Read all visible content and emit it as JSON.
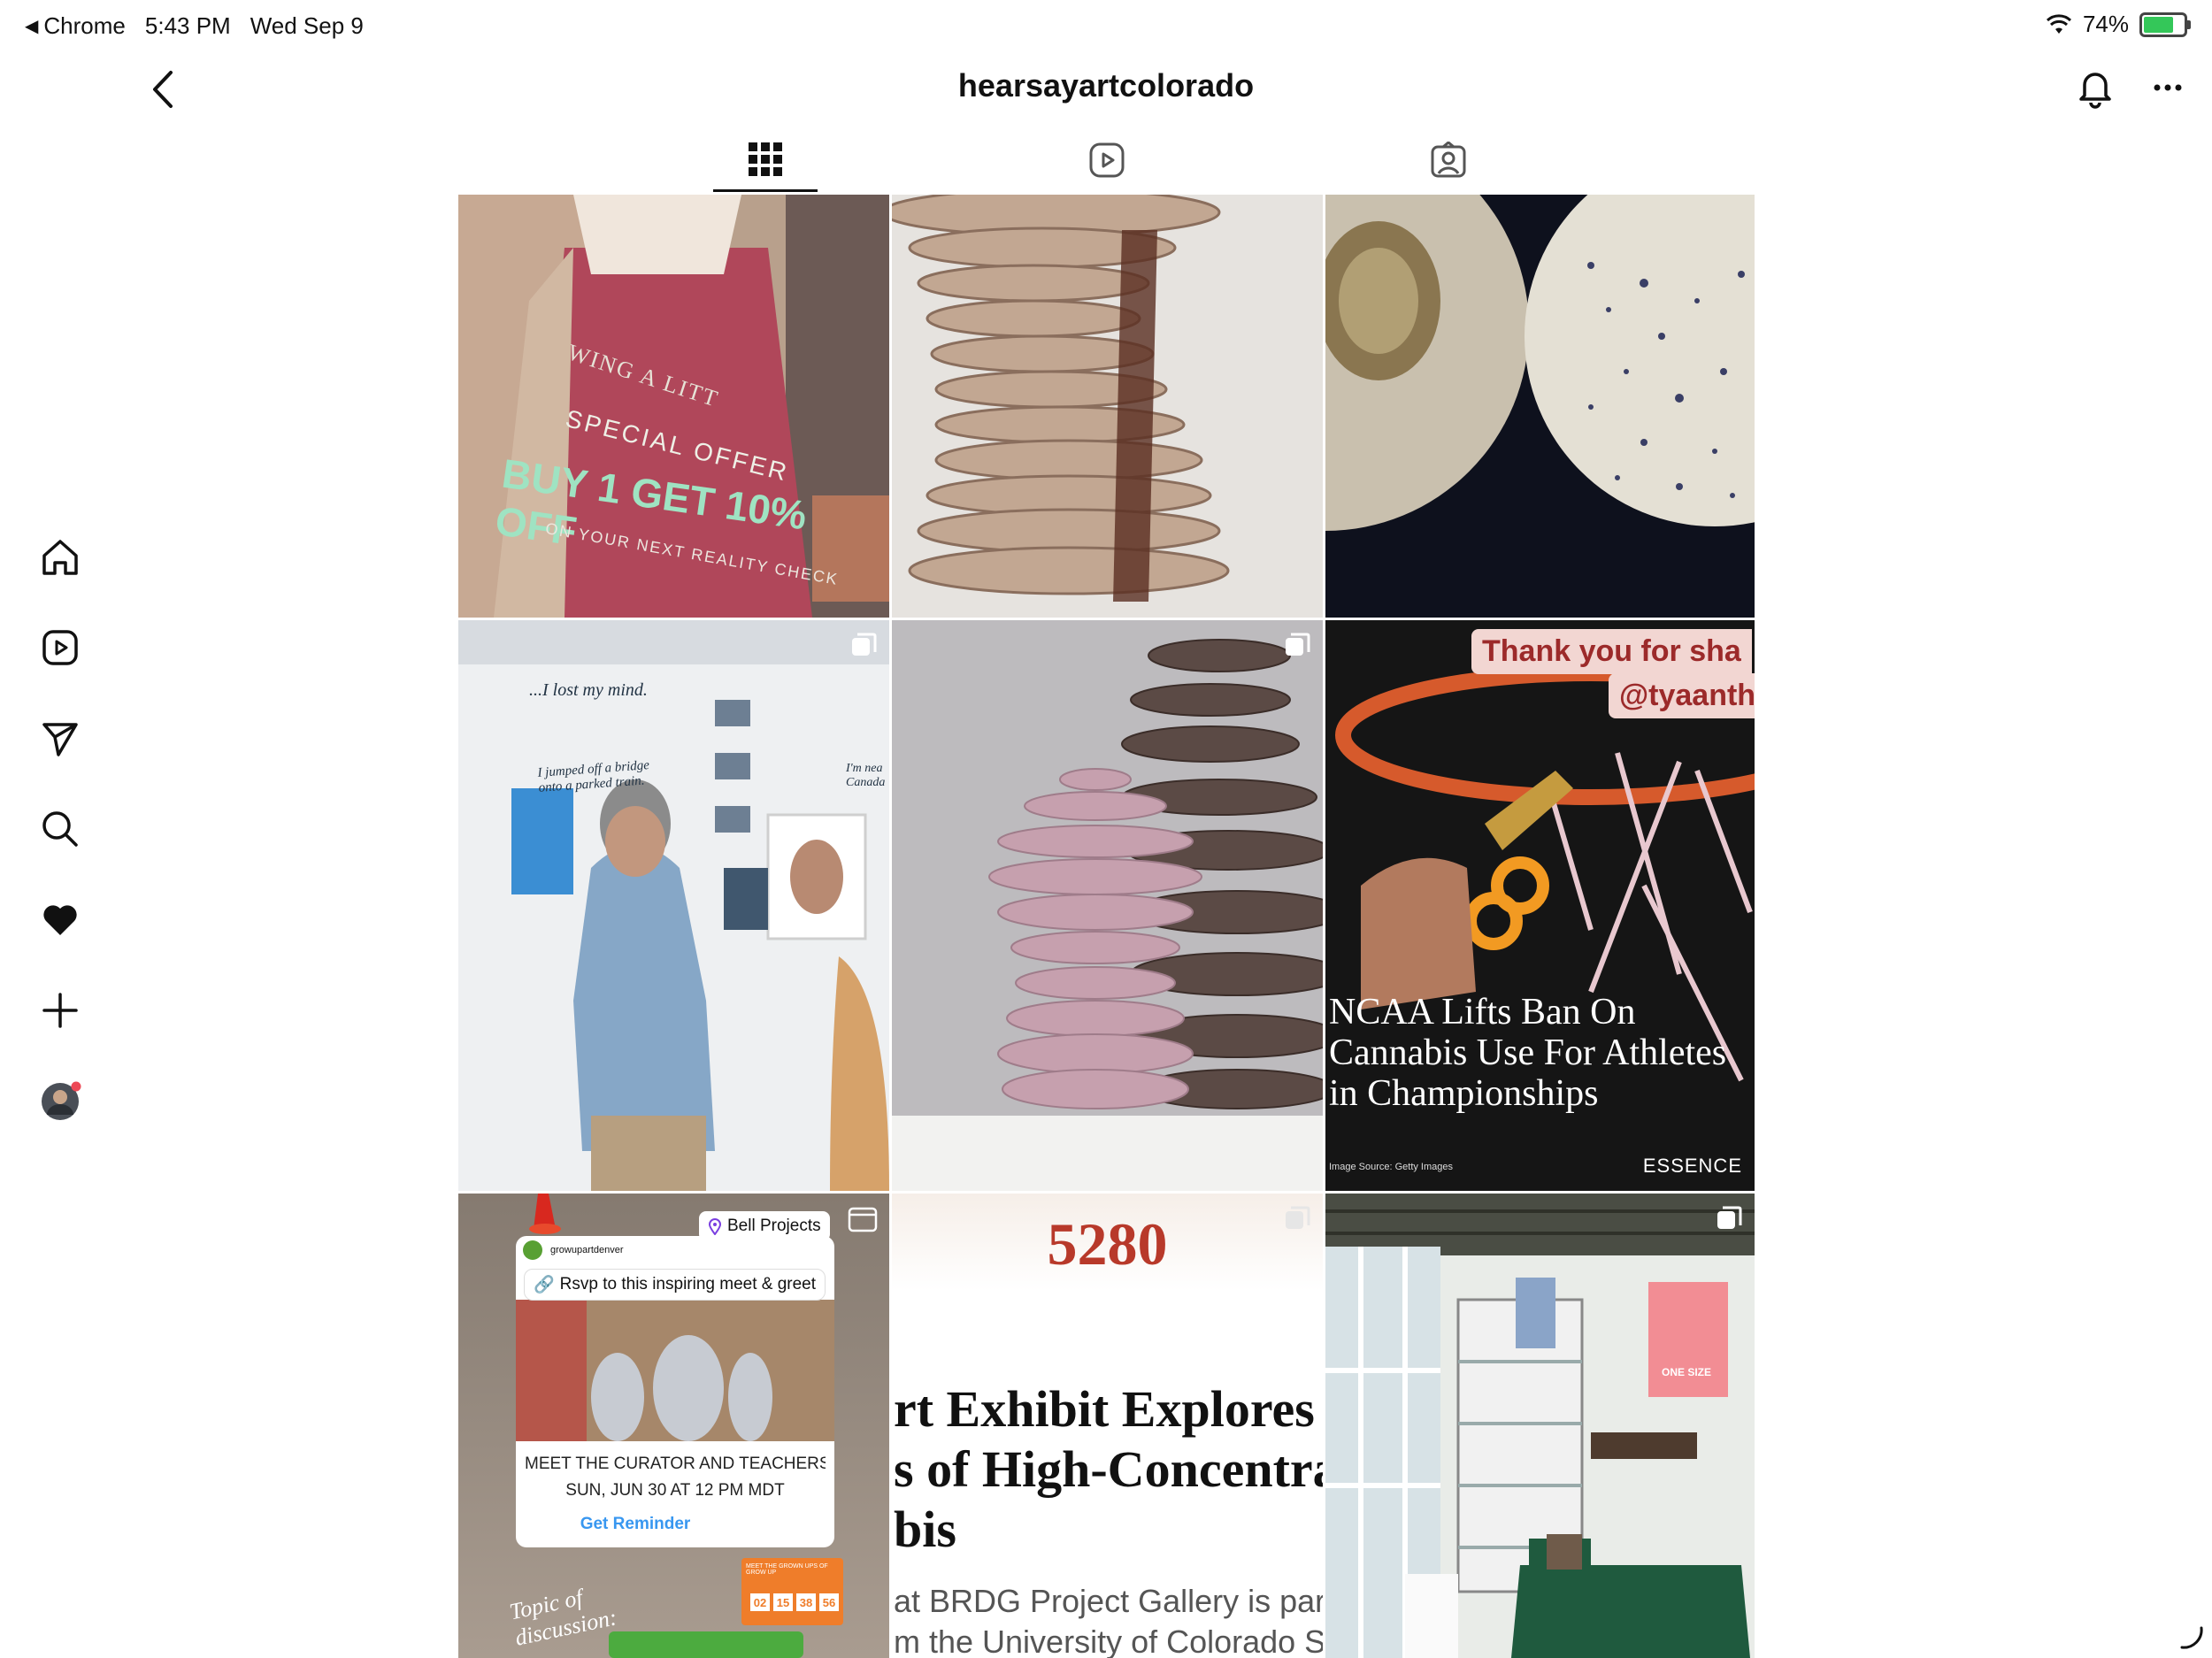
{
  "status_bar": {
    "back_app": "Chrome",
    "time": "5:43 PM",
    "date": "Wed Sep 9",
    "battery": "74%",
    "battery_level": 0.74
  },
  "header": {
    "title": "hearsayartcolorado"
  },
  "tabs": [
    {
      "name": "grid-icon",
      "active": true
    },
    {
      "name": "reels-icon",
      "active": false
    },
    {
      "name": "tagged-icon",
      "active": false
    }
  ],
  "sidebar": [
    "home-icon",
    "reels-icon",
    "direct-icon",
    "search-icon",
    "heart-icon",
    "create-icon",
    "profile-avatar"
  ],
  "posts": {
    "p1": {
      "line1": "WING A LITT",
      "line2": "SPECIAL OFFER",
      "line3": "BUY 1 GET 10% OFF",
      "line4": "ON YOUR NEXT REALITY CHECK"
    },
    "p4": {
      "note1": "...I lost my mind.",
      "note2": "I jumped off a bridge onto a parked train.",
      "note3": "I'm nea Canada"
    },
    "p6": {
      "banner1": "Thank you for sha",
      "banner2": "@tyaanth",
      "headline": "NCAA Lifts Ban On Cannabis Use For Athletes in Championships",
      "source": "Image Source: Getty Images",
      "brand": "ESSENCE"
    },
    "p7": {
      "location": "Bell Projects",
      "account": "growupartdenver",
      "link": "Rsvp to this inspiring meet & greet",
      "event_title": "MEET THE CURATOR AND TEACHERS OF \"G...",
      "event_date": "SUN, JUN 30 AT 12 PM MDT",
      "reminder": "Get Reminder",
      "countdown_label": "MEET THE GROWN UPS OF GROW UP",
      "countdown": [
        "02",
        "15",
        "38",
        "56"
      ],
      "handwriting": "Topic of discussion:"
    },
    "p8": {
      "brand": "5280",
      "headline1": "rt Exhibit Explores th",
      "headline2": "s of High-Concentrati",
      "headline3": "bis",
      "body1": "at BRDG Project Gallery is part",
      "body2": "m the University of Colorado Sc"
    },
    "p9": {
      "banner": "ONE SIZE"
    }
  },
  "colors": {
    "accent_red": "#ed4956",
    "ios_blue": "#3897f0",
    "green_battery": "#34c759"
  }
}
